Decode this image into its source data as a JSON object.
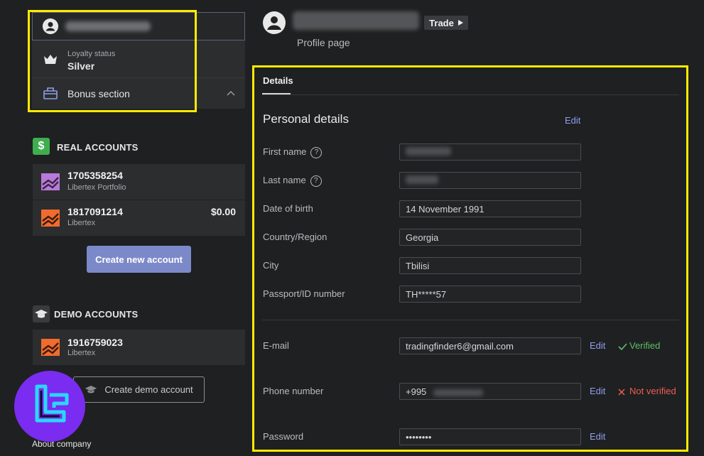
{
  "sidebar": {
    "loyalty_label": "Loyalty status",
    "loyalty_value": "Silver",
    "bonus_label": "Bonus section",
    "real_accounts_title": "REAL ACCOUNTS",
    "real_accounts": [
      {
        "id": "1705358254",
        "type": "Libertex Portfolio",
        "balance": ""
      },
      {
        "id": "1817091214",
        "type": "Libertex",
        "balance": "$0.00"
      }
    ],
    "create_new_account": "Create new account",
    "demo_accounts_title": "DEMO ACCOUNTS",
    "demo_accounts": [
      {
        "id": "1916759023",
        "type": "Libertex"
      }
    ],
    "create_demo_account": "Create demo account",
    "about_company": "About company"
  },
  "header": {
    "trade_button": "Trade",
    "profile_page": "Profile page"
  },
  "details": {
    "tab_label": "Details",
    "section_title": "Personal details",
    "edit_label": "Edit",
    "fields": [
      {
        "label": "First name",
        "value": ""
      },
      {
        "label": "Last name",
        "value": ""
      },
      {
        "label": "Date of birth",
        "value": "14 November 1991"
      },
      {
        "label": "Country/Region",
        "value": "Georgia"
      },
      {
        "label": "City",
        "value": "Tbilisi"
      },
      {
        "label": "Passport/ID number",
        "value": "TH*****57"
      }
    ],
    "email": {
      "label": "E-mail",
      "value": "tradingfinder6@gmail.com",
      "edit": "Edit",
      "status": "Verified"
    },
    "phone": {
      "label": "Phone number",
      "value": "+995",
      "edit": "Edit",
      "status": "Not verified"
    },
    "password": {
      "label": "Password",
      "value": "••••••••",
      "edit": "Edit"
    }
  },
  "colors": {
    "accent": "#7c89c9",
    "link": "#8f9ef0",
    "verified": "#5cbf6b",
    "not_verified": "#f25c54",
    "highlight": "#ffeb00"
  }
}
